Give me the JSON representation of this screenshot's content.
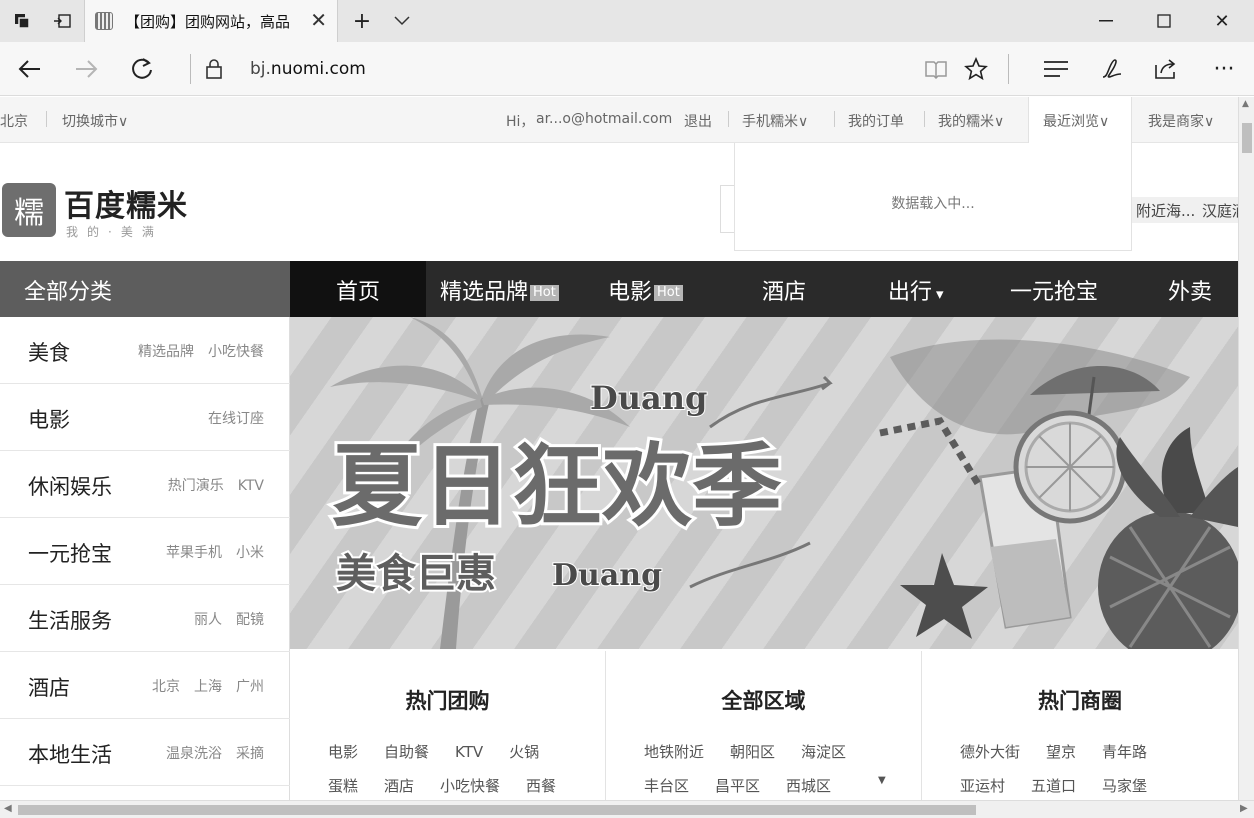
{
  "browser": {
    "tab_title": "【团购】团购网站，高品",
    "url_subdomain": "bj.",
    "url_domain": "nuomi.com",
    "icons": [
      "tab-manager-icon",
      "set-aside-icon",
      "new-tab-icon",
      "tab-list-icon",
      "back-icon",
      "forward-icon",
      "refresh-icon",
      "lock-icon",
      "reading-view-icon",
      "favorite-star-icon",
      "hub-icon",
      "web-note-icon",
      "share-icon",
      "more-icon",
      "minimize-icon",
      "maximize-icon",
      "close-icon"
    ]
  },
  "topbar": {
    "city": "北京",
    "switch_city": "切换城市∨",
    "greeting": "Hi，",
    "user_email": "ar...o@hotmail.com",
    "logout": "退出",
    "mobile": "手机糯米∨",
    "orders": "我的订单",
    "my_nuomi": "我的糯米∨",
    "recent": "最近浏览∨",
    "merchant": "我是商家∨"
  },
  "recent_dropdown": {
    "loading": "数据载入中..."
  },
  "logo": {
    "mark": "糯",
    "title": "百度糯米",
    "slogan": "我的·美满"
  },
  "hot_keywords": [
    "附近海...",
    "汉庭酒"
  ],
  "nav": {
    "all_categories": "全部分类",
    "items": [
      {
        "label": "首页",
        "hot": ""
      },
      {
        "label": "精选品牌",
        "hot": "Hot"
      },
      {
        "label": "电影",
        "hot": "Hot"
      },
      {
        "label": "酒店",
        "hot": ""
      },
      {
        "label": "出行",
        "hot": ""
      },
      {
        "label": "一元抢宝",
        "hot": ""
      },
      {
        "label": "外卖",
        "hot": ""
      }
    ],
    "dropdown_arrow": "▾"
  },
  "categories": [
    {
      "name": "美食",
      "subs": [
        "精选品牌",
        "小吃快餐"
      ]
    },
    {
      "name": "电影",
      "subs": [
        "在线订座"
      ]
    },
    {
      "name": "休闲娱乐",
      "subs": [
        "热门演乐",
        "KTV"
      ]
    },
    {
      "name": "一元抢宝",
      "subs": [
        "苹果手机",
        "小米"
      ]
    },
    {
      "name": "生活服务",
      "subs": [
        "丽人",
        "配镜"
      ]
    },
    {
      "name": "酒店",
      "subs": [
        "北京",
        "上海",
        "广州"
      ]
    },
    {
      "name": "本地生活",
      "subs": [
        "温泉洗浴",
        "采摘"
      ]
    }
  ],
  "banner": {
    "headline": "夏日狂欢季",
    "sub": "美食巨惠",
    "duang_top": "Duang",
    "duang_bottom": "Duang"
  },
  "panels": [
    {
      "title": "热门团购",
      "row1": [
        "电影",
        "自助餐",
        "KTV",
        "火锅"
      ],
      "row2": [
        "蛋糕",
        "酒店",
        "小吃快餐",
        "西餐"
      ]
    },
    {
      "title": "全部区域",
      "row1": [
        "地铁附近",
        "朝阳区",
        "海淀区"
      ],
      "row2": [
        "丰台区",
        "昌平区",
        "西城区"
      ]
    },
    {
      "title": "热门商圈",
      "row1": [
        "德外大街",
        "望京",
        "青年路"
      ],
      "row2": [
        "亚运村",
        "五道口",
        "马家堡"
      ]
    }
  ]
}
